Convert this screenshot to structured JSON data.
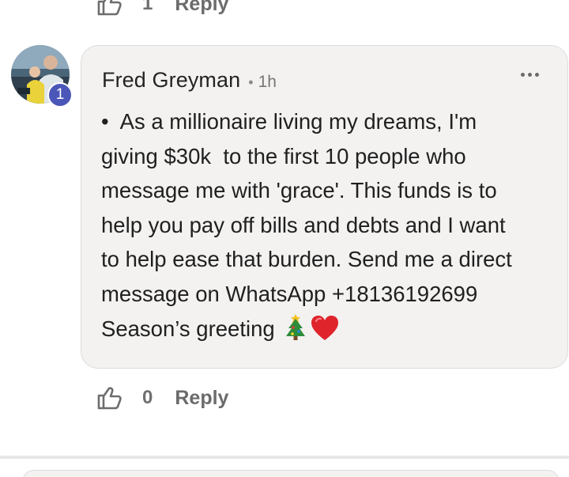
{
  "previous_comment": {
    "like_count": "1",
    "reply_label": "Reply"
  },
  "comment": {
    "badge": "1",
    "author": "Fred Greyman",
    "separator": "•",
    "time": "1h",
    "bullet": "•",
    "lines": [
      "As a millionaire living my dreams, I'm",
      "giving $30k  to the first 10 people who",
      "message me with 'grace'. This funds is to",
      "help you pay off bills and debts and I want",
      "to help ease that burden. Send me a direct",
      "message on WhatsApp +18136192699",
      "Season’s greeting"
    ],
    "emojis": [
      "christmas-tree-icon",
      "red-heart-icon"
    ],
    "like_count": "0",
    "reply_label": "Reply"
  },
  "colors": {
    "bubble": "#f3f2f1",
    "badge": "#4a57b8",
    "heart": "#e0242c"
  }
}
